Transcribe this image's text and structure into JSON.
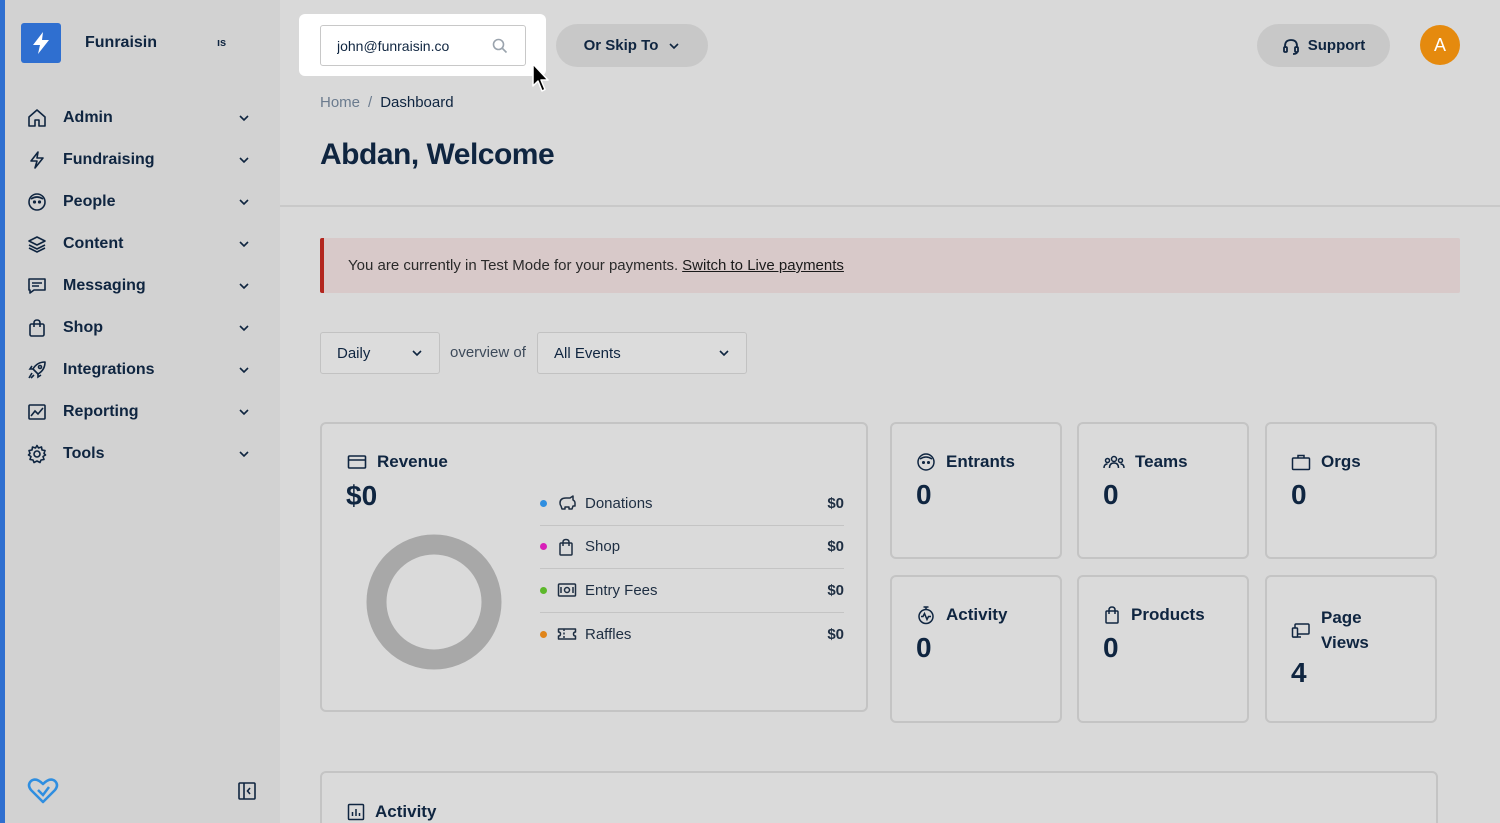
{
  "sidebar": {
    "brand": "Funraisin",
    "brand_extra": "ıs",
    "items": [
      {
        "label": "Admin",
        "icon": "home-icon"
      },
      {
        "label": "Fundraising",
        "icon": "lightning-icon"
      },
      {
        "label": "People",
        "icon": "face-icon"
      },
      {
        "label": "Content",
        "icon": "layers-icon"
      },
      {
        "label": "Messaging",
        "icon": "message-icon"
      },
      {
        "label": "Shop",
        "icon": "shopping-bag-icon"
      },
      {
        "label": "Integrations",
        "icon": "rocket-icon"
      },
      {
        "label": "Reporting",
        "icon": "chart-icon"
      },
      {
        "label": "Tools",
        "icon": "gear-icon"
      }
    ]
  },
  "header": {
    "search_value": "john@funraisin.co",
    "skip_label": "Or Skip To",
    "support_label": "Support",
    "avatar_initial": "A"
  },
  "breadcrumb": {
    "home": "Home",
    "sep": "/",
    "current": "Dashboard"
  },
  "page_title": "Abdan, Welcome",
  "alert": {
    "text": "You are currently in Test Mode for your payments.",
    "link": "Switch to Live payments"
  },
  "filters": {
    "period": "Daily",
    "connector": "overview of",
    "scope": "All Events"
  },
  "revenue": {
    "title": "Revenue",
    "total": "$0",
    "rows": [
      {
        "label": "Donations",
        "value": "$0",
        "color": "#2f8ee0"
      },
      {
        "label": "Shop",
        "value": "$0",
        "color": "#d81fb8"
      },
      {
        "label": "Entry Fees",
        "value": "$0",
        "color": "#5cb82a"
      },
      {
        "label": "Raffles",
        "value": "$0",
        "color": "#e0851a"
      }
    ]
  },
  "stats": {
    "entrants": {
      "label": "Entrants",
      "value": "0"
    },
    "teams": {
      "label": "Teams",
      "value": "0"
    },
    "orgs": {
      "label": "Orgs",
      "value": "0"
    },
    "activity": {
      "label": "Activity",
      "value": "0"
    },
    "products": {
      "label": "Products",
      "value": "0"
    },
    "page_views": {
      "label": "Page Views",
      "value": "4"
    }
  },
  "activity_section": {
    "title": "Activity"
  }
}
